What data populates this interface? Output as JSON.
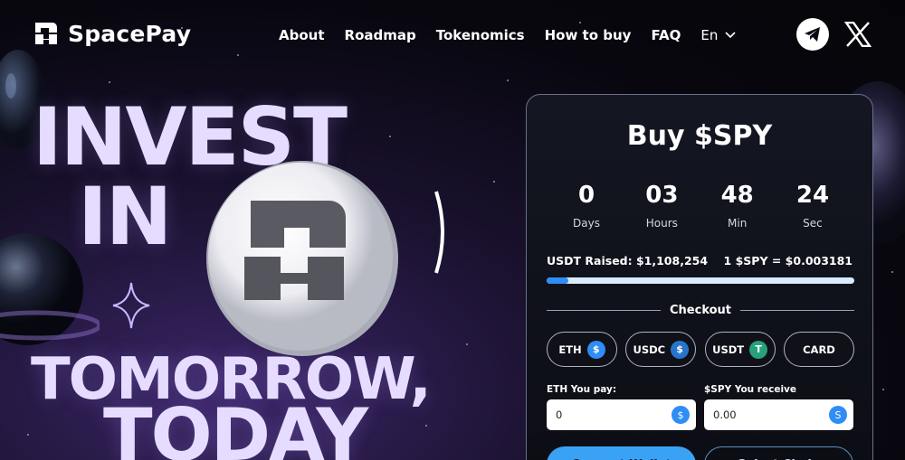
{
  "brand": {
    "name": "SpacePay"
  },
  "nav": {
    "items": [
      "About",
      "Roadmap",
      "Tokenomics",
      "How to buy",
      "FAQ"
    ],
    "language": "En"
  },
  "social": {
    "telegram_icon": "telegram-icon",
    "x_icon": "x-icon"
  },
  "hero": {
    "line1": "INVEST",
    "line2": "IN",
    "line3": "TOMORROW,",
    "line4": "TODAY"
  },
  "widget": {
    "title": "Buy $SPY",
    "countdown": [
      {
        "value": "0",
        "label": "Days"
      },
      {
        "value": "03",
        "label": "Hours"
      },
      {
        "value": "48",
        "label": "Min"
      },
      {
        "value": "24",
        "label": "Sec"
      }
    ],
    "raised": "USDT Raised: $1,108,254",
    "rate": "1 $SPY = $0.003181",
    "progress_percent": 7,
    "checkout_label": "Checkout",
    "payment_options": [
      {
        "label": "ETH",
        "icon": "eth-icon",
        "color": "#2f8df5"
      },
      {
        "label": "USDC",
        "icon": "usdc-icon",
        "color": "#2775ca"
      },
      {
        "label": "USDT",
        "icon": "usdt-icon",
        "color": "#26a17b"
      },
      {
        "label": "CARD",
        "icon": "",
        "color": ""
      }
    ],
    "pay_label": "ETH You pay:",
    "pay_value": "0",
    "receive_label": "$SPY You receive",
    "receive_value": "0.00",
    "connect_button": "Connect Wallet",
    "select_chain_button": "Select Chain"
  },
  "colors": {
    "accent": "#3aa2f5",
    "hero_text": "#e6dcff",
    "progress_fill": "#2f8df5"
  }
}
